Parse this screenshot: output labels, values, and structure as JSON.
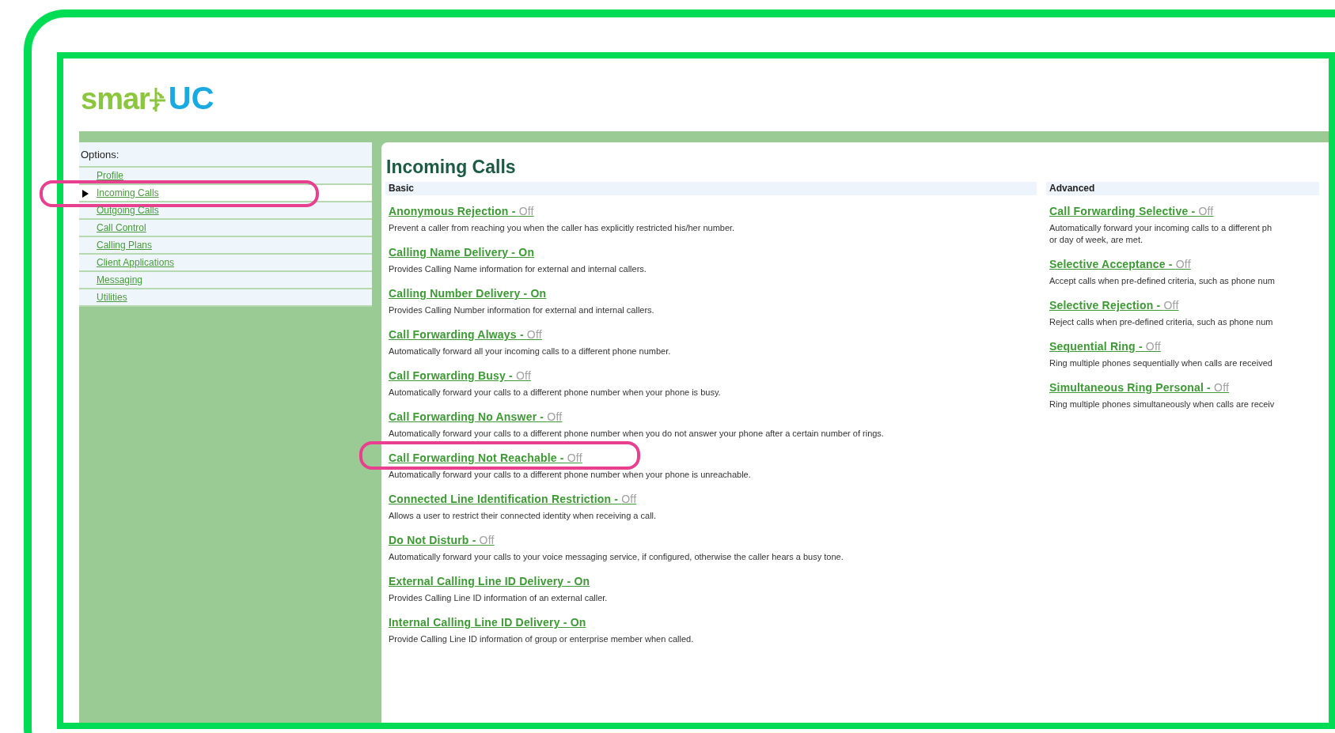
{
  "logo": {
    "left": "smar",
    "right": "UC"
  },
  "sidebar": {
    "heading": "Options:",
    "items": [
      {
        "label": "Profile",
        "selected": false,
        "highlighted": false
      },
      {
        "label": "Incoming Calls",
        "selected": true,
        "highlighted": true
      },
      {
        "label": "Outgoing Calls",
        "selected": false,
        "highlighted": false
      },
      {
        "label": "Call Control",
        "selected": false,
        "highlighted": false
      },
      {
        "label": "Calling Plans",
        "selected": false,
        "highlighted": false
      },
      {
        "label": "Client Applications",
        "selected": false,
        "highlighted": false
      },
      {
        "label": "Messaging",
        "selected": false,
        "highlighted": false
      },
      {
        "label": "Utilities",
        "selected": false,
        "highlighted": false
      }
    ]
  },
  "page_title": "Incoming Calls",
  "sections": [
    {
      "heading": "Basic",
      "items": [
        {
          "title": "Anonymous Rejection - ",
          "status": "Off",
          "on": false,
          "highlighted": false,
          "description": [
            "Prevent a caller from reaching you when the caller has explicitly restricted his/her number."
          ]
        },
        {
          "title": "Calling Name Delivery - ",
          "status": "On",
          "on": true,
          "highlighted": false,
          "description": [
            "Provides Calling Name information for external and internal callers."
          ]
        },
        {
          "title": "Calling Number Delivery - ",
          "status": "On",
          "on": true,
          "highlighted": false,
          "description": [
            "Provides Calling Number information for external and internal callers."
          ]
        },
        {
          "title": "Call Forwarding Always - ",
          "status": "Off",
          "on": false,
          "highlighted": false,
          "description": [
            "Automatically forward all your incoming calls to a different phone number."
          ]
        },
        {
          "title": "Call Forwarding Busy - ",
          "status": "Off",
          "on": false,
          "highlighted": false,
          "description": [
            "Automatically forward your calls to a different phone number when your phone is busy."
          ]
        },
        {
          "title": "Call Forwarding No Answer - ",
          "status": "Off",
          "on": false,
          "highlighted": false,
          "description": [
            "Automatically forward your calls to a different phone number when you do not answer your phone after a certain number of rings."
          ]
        },
        {
          "title": "Call Forwarding Not Reachable - ",
          "status": "Off",
          "on": false,
          "highlighted": true,
          "description": [
            "Automatically forward your calls to a different phone number when your phone is unreachable."
          ]
        },
        {
          "title": "Connected Line Identification Restriction - ",
          "status": "Off",
          "on": false,
          "highlighted": false,
          "description": [
            "Allows a user to restrict their connected identity when receiving a call."
          ]
        },
        {
          "title": "Do Not Disturb - ",
          "status": "Off",
          "on": false,
          "highlighted": false,
          "description": [
            "Automatically forward your calls to your voice messaging service, if configured, otherwise the caller hears a busy tone."
          ]
        },
        {
          "title": "External Calling Line ID Delivery - ",
          "status": "On",
          "on": true,
          "highlighted": false,
          "description": [
            "Provides Calling Line ID information of an external caller."
          ]
        },
        {
          "title": "Internal Calling Line ID Delivery - ",
          "status": "On",
          "on": true,
          "highlighted": false,
          "description": [
            "Provide Calling Line ID information of group or enterprise member when called."
          ]
        }
      ]
    },
    {
      "heading": "Advanced",
      "items": [
        {
          "title": "Call Forwarding Selective - ",
          "status": "Off",
          "on": false,
          "highlighted": false,
          "description": [
            "Automatically forward your incoming calls to a different ph",
            "or day of week, are met."
          ]
        },
        {
          "title": "Selective Acceptance - ",
          "status": "Off",
          "on": false,
          "highlighted": false,
          "description": [
            "Accept calls when pre-defined criteria, such as phone num"
          ]
        },
        {
          "title": "Selective Rejection - ",
          "status": "Off",
          "on": false,
          "highlighted": false,
          "description": [
            "Reject calls when pre-defined criteria, such as phone num"
          ]
        },
        {
          "title": "Sequential Ring - ",
          "status": "Off",
          "on": false,
          "highlighted": false,
          "description": [
            "Ring multiple phones sequentially when calls are received"
          ]
        },
        {
          "title": "Simultaneous Ring Personal - ",
          "status": "Off",
          "on": false,
          "highlighted": false,
          "description": [
            "Ring multiple phones simultaneously when calls are receiv"
          ]
        }
      ]
    }
  ]
}
